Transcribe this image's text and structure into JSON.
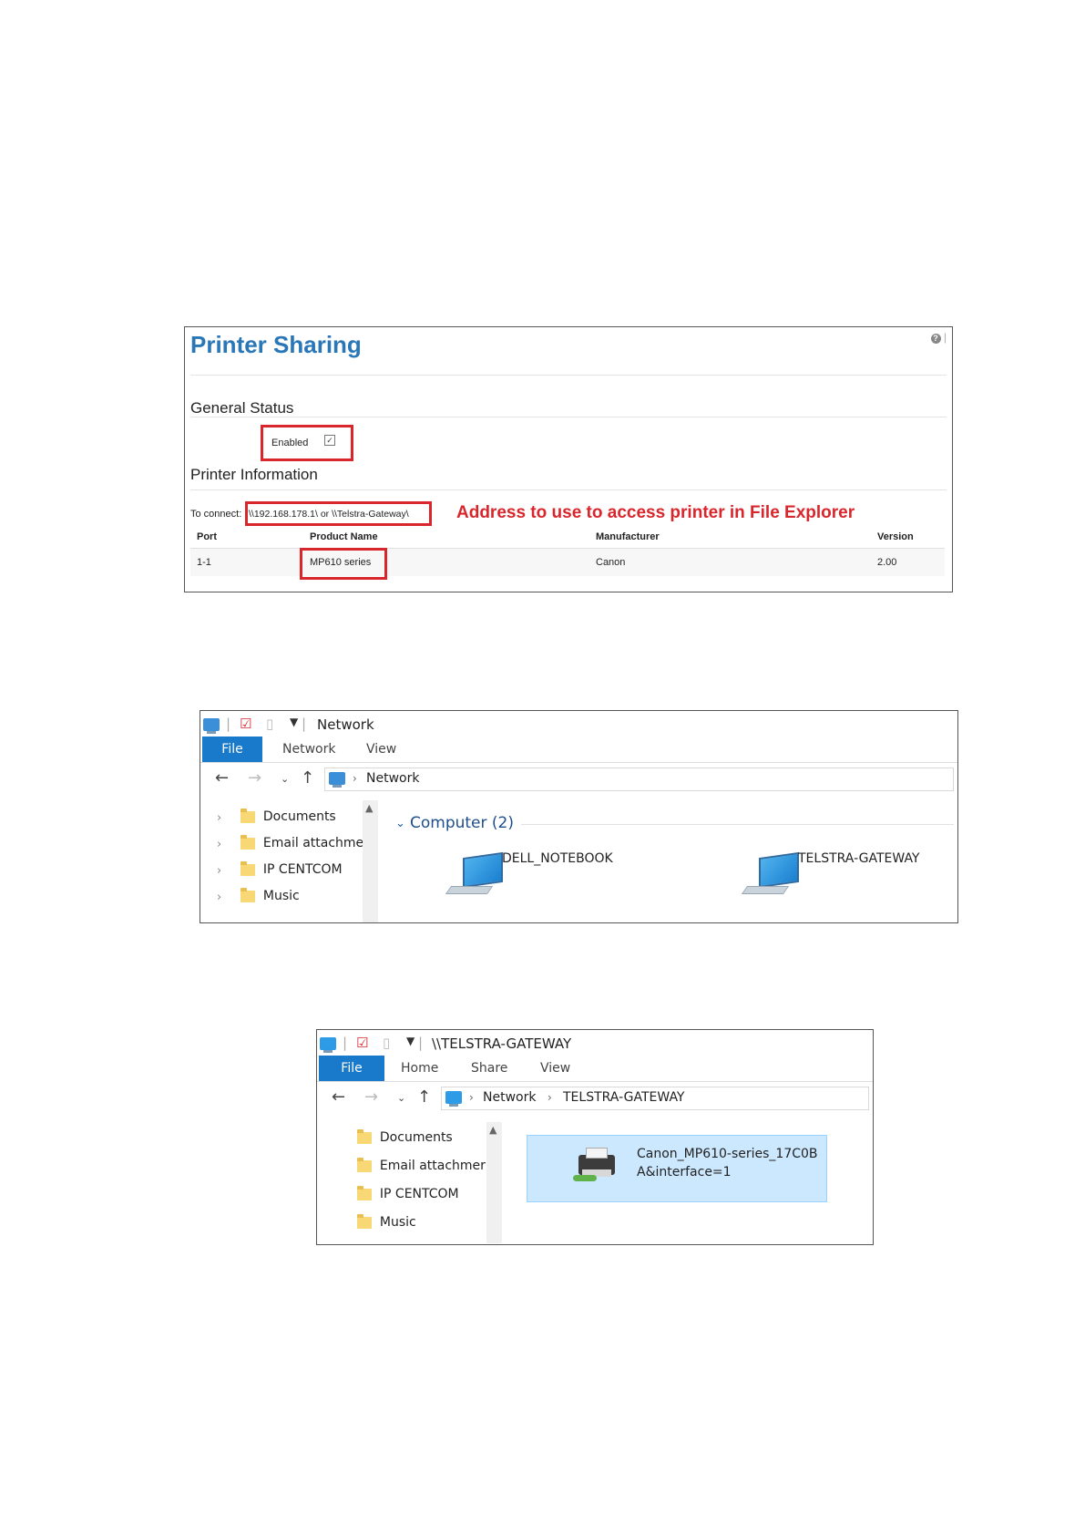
{
  "printer_sharing": {
    "title": "Printer Sharing",
    "help_icon": "help-icon",
    "general_status_heading": "General Status",
    "enabled_label": "Enabled",
    "enabled_checked": true,
    "printer_information_heading": "Printer Information",
    "connect_label": "To connect:",
    "connect_address": "\\\\192.168.178.1\\ or \\\\Telstra-Gateway\\",
    "annotation": "Address to use to access printer in File Explorer",
    "highlight_color": "#d9262c",
    "table": {
      "headers": [
        "Port",
        "Product Name",
        "Manufacturer",
        "Version"
      ],
      "rows": [
        [
          "1-1",
          "MP610 series",
          "Canon",
          "2.00"
        ]
      ]
    }
  },
  "explorer_network": {
    "title": "Network",
    "tabs": [
      "File",
      "Network",
      "View"
    ],
    "address": [
      "Network"
    ],
    "nav_items": [
      "Documents",
      "Email attachmer",
      "IP CENTCOM",
      "Music"
    ],
    "group_heading": "Computer (2)",
    "computers": [
      "DELL_NOTEBOOK",
      "TELSTRA-GATEWAY"
    ]
  },
  "explorer_gateway": {
    "title": "\\\\TELSTRA-GATEWAY",
    "tabs": [
      "File",
      "Home",
      "Share",
      "View"
    ],
    "address": [
      "Network",
      "TELSTRA-GATEWAY"
    ],
    "nav_items": [
      "Documents",
      "Email attachmer",
      "IP CENTCOM",
      "Music"
    ],
    "printer_name_line1": "Canon_MP610-series_17C0B",
    "printer_name_line2": "A&interface=1"
  }
}
